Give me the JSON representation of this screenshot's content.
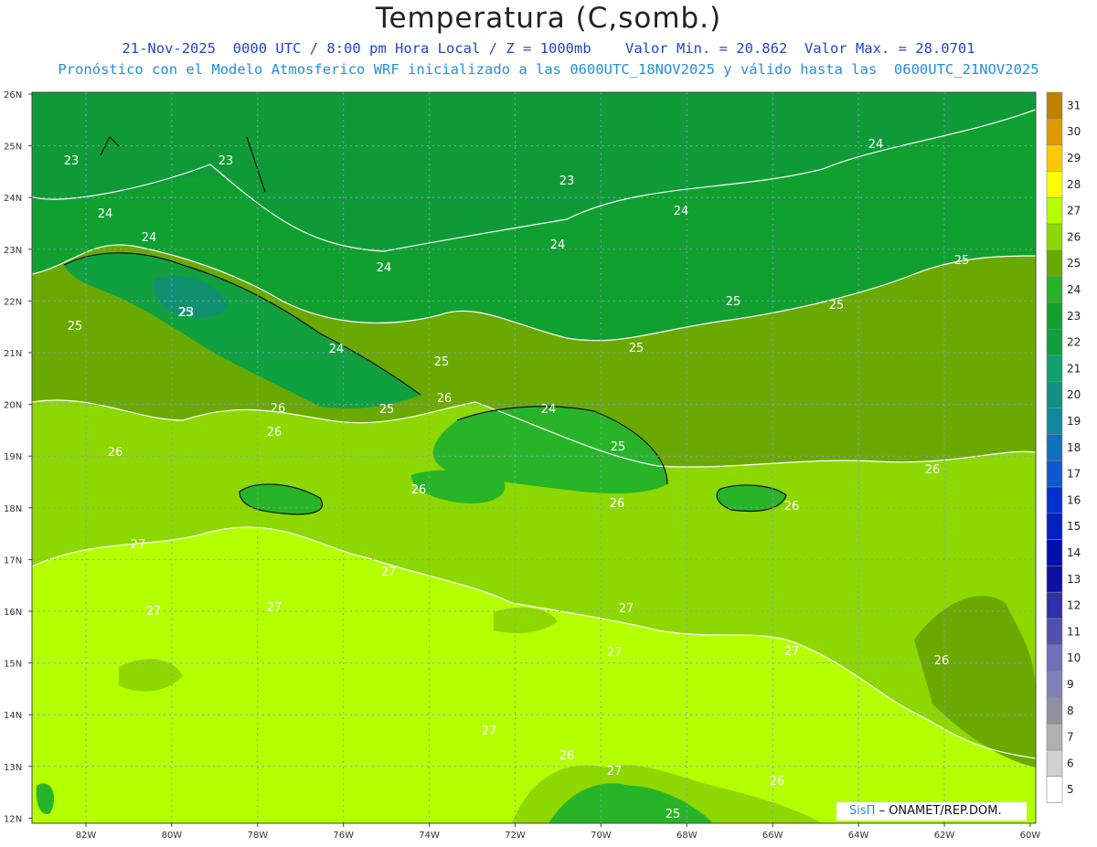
{
  "header": {
    "title": "Temperatura (C,somb.)",
    "line1": "21-Nov-2025  0000 UTC / 8:00 pm Hora Local / Z = 1000mb    Valor Min. = 20.862  Valor Max. = 28.0701",
    "line2": "Pronóstico con el Modelo Atmosferico WRF inicializado a las 0600UTC_18NOV2025 y válido hasta las  0600UTC_21NOV2025"
  },
  "axes": {
    "lat_labels": [
      "26N",
      "25N",
      "24N",
      "23N",
      "22N",
      "21N",
      "20N",
      "19N",
      "18N",
      "17N",
      "16N",
      "15N",
      "14N",
      "13N",
      "12N"
    ],
    "lon_labels": [
      "82W",
      "80W",
      "78W",
      "76W",
      "74W",
      "72W",
      "70W",
      "68W",
      "66W",
      "64W",
      "62W",
      "60W"
    ]
  },
  "colorbar": {
    "labels": [
      "31",
      "30",
      "29",
      "28",
      "27",
      "26",
      "25",
      "24",
      "23",
      "22",
      "21",
      "20",
      "19",
      "18",
      "17",
      "16",
      "15",
      "14",
      "13",
      "12",
      "11",
      "10",
      "9",
      "8",
      "7",
      "6",
      "5"
    ],
    "colors": [
      "#c08000",
      "#e09a00",
      "#ffc800",
      "#ffff00",
      "#b4ff00",
      "#8cd800",
      "#6aaa00",
      "#28b428",
      "#10a030",
      "#10a040",
      "#10a070",
      "#109080",
      "#1088a0",
      "#1070c0",
      "#1058d0",
      "#0030d0",
      "#0020c0",
      "#0010b0",
      "#1010a0",
      "#3030a8",
      "#5050b0",
      "#7070b8",
      "#8080b8",
      "#9090a0",
      "#b0b0b0",
      "#d0d0d0",
      "#ffffff"
    ]
  },
  "contour_labels": [
    "23",
    "23",
    "23",
    "24",
    "24",
    "24",
    "24",
    "24",
    "24",
    "25",
    "25",
    "25",
    "25",
    "25",
    "25",
    "25",
    "26",
    "26",
    "26",
    "26",
    "26",
    "26",
    "26",
    "26",
    "27",
    "27",
    "27",
    "27",
    "27",
    "27",
    "27",
    "27",
    "27",
    "26",
    "26",
    "24",
    "23",
    "25",
    "25",
    "26",
    "24",
    "25"
  ],
  "credit": {
    "brand": "SisΠ",
    "text": "– ONAMET/REP.DOM."
  }
}
